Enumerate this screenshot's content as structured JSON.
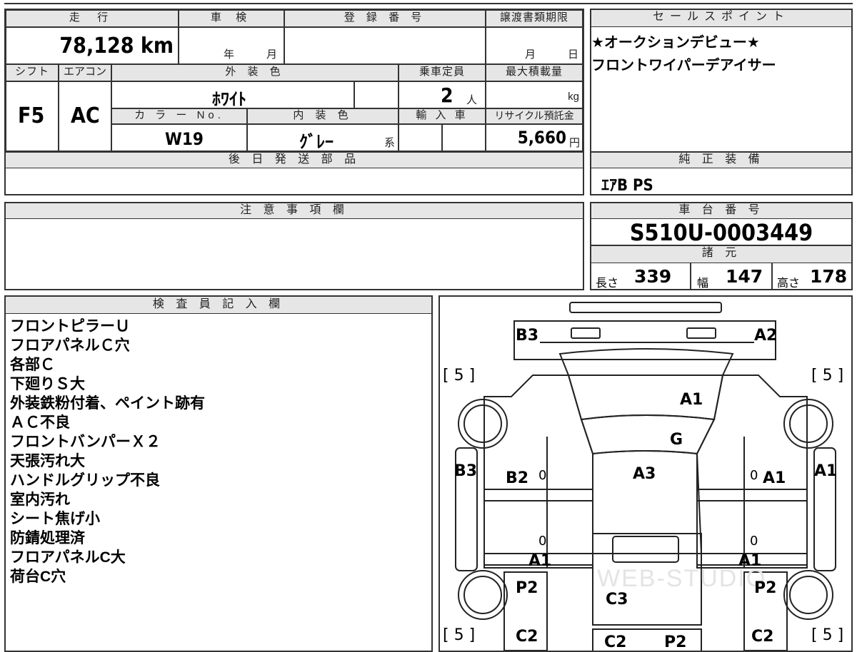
{
  "vehicle_info": {
    "mileage_label": "走 行",
    "mileage_value": "78,128 km",
    "inspection_label": "車 検",
    "inspection_year": "年",
    "inspection_month": "月",
    "registration_label": "登 録 番 号",
    "transfer_deadline_label": "譲渡書類期限",
    "transfer_month": "月",
    "transfer_day": "日",
    "shift_label": "シフト",
    "shift_value": "F5",
    "ac_label": "エアコン",
    "ac_value": "AC",
    "exterior_color_label": "外 装 色",
    "exterior_color_value": "ﾎﾜｲﾄ",
    "capacity_label": "乗車定員",
    "capacity_value": "2",
    "capacity_unit": "人",
    "max_load_label": "最大積載量",
    "max_load_unit": "kg",
    "color_no_label": "カ ラ ー No.",
    "color_no_value": "W19",
    "interior_color_label": "内 装 色",
    "interior_color_value": "ｸﾞﾚｰ",
    "interior_color_suffix": "系",
    "import_label": "輸 入 車",
    "recycle_label": "リサイクル預託金",
    "recycle_value": "5,660",
    "recycle_unit": "円"
  },
  "later_parts": {
    "label": "後 日 発 送 部 品",
    "value": ""
  },
  "notes": {
    "label": "注 意 事 項 欄",
    "value": ""
  },
  "sales_points": {
    "label": "セールスポイント",
    "lines": [
      "★オークションデビュー★",
      "フロントワイパーデアイサー"
    ]
  },
  "genuine_equipment": {
    "label": "純 正 装 備",
    "value": "ｴｱB PS"
  },
  "chassis": {
    "label": "車 台 番 号",
    "value": "S510U-0003449"
  },
  "specs": {
    "label": "諸 元",
    "length_label": "長さ",
    "length_value": "339",
    "width_label": "幅",
    "width_value": "147",
    "height_label": "高さ",
    "height_value": "178"
  },
  "inspector": {
    "label": "検 査 員 記 入 欄",
    "lines": [
      "フロントピラーＵ",
      "フロアパネルＣ穴",
      "各部Ｃ",
      "下廻りＳ大",
      "外装鉄粉付着、ペイント跡有",
      "ＡＣ不良",
      "フロントバンパーＸ２",
      "天張汚れ大",
      "ハンドルグリップ不良",
      "室内汚れ",
      "シート焦げ小",
      "防錆処理済",
      "フロアパネルC大",
      "荷台C穴"
    ]
  },
  "diagram": {
    "labels": {
      "front_left": "B3",
      "front_right": "A2",
      "tire_fl": "[ 5 ]",
      "tire_fr": "[ 5 ]",
      "hood": "A1",
      "windshield": "G",
      "roof": "A3",
      "left_front": "B3",
      "left_door": "B2",
      "right_door": "A1",
      "right_front": "A1",
      "left_sill": "A1",
      "right_sill": "A1",
      "left_rear": "P2",
      "right_rear": "P2",
      "bed": "C3",
      "tire_rl": "[ 5 ]",
      "tire_rr": "[ 5 ]",
      "left_bottom": "C2",
      "right_bottom": "C2",
      "bed_bottom_left": "C2",
      "bed_bottom_right": "P2",
      "zero_a": "0",
      "zero_b": "0",
      "zero_c": "0",
      "zero_d": "0"
    },
    "watermark": "WEB-STUDIO"
  }
}
